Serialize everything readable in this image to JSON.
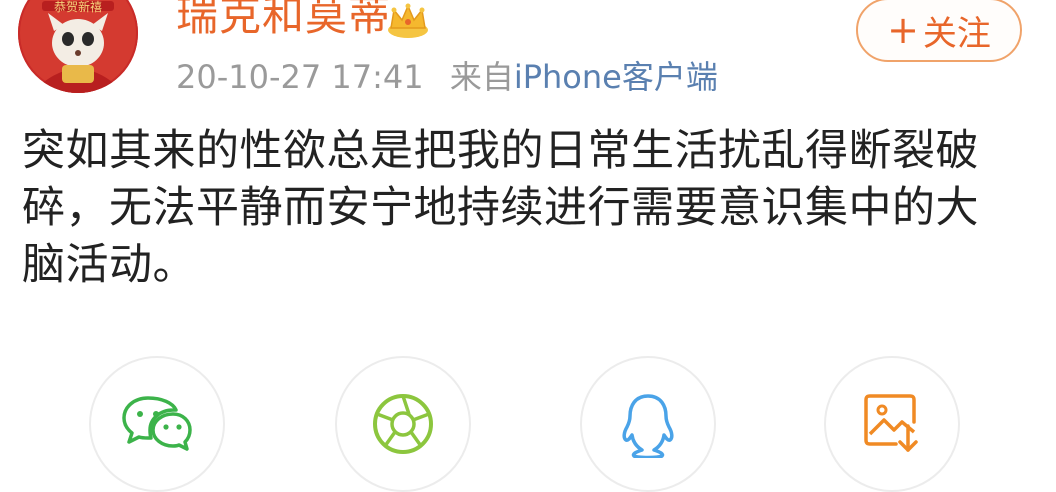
{
  "post": {
    "author": {
      "name": "瑞克和莫蒂",
      "avatar_text": "恭贺新禧",
      "badge_icon": "crown-icon"
    },
    "follow_button": {
      "icon": "plus-icon",
      "label": "关注"
    },
    "meta": {
      "time": "20-10-27 17:41",
      "source_prefix": "来自",
      "source": "iPhone客户端"
    },
    "content": "突如其来的性欲总是把我的日常生活扰乱得断裂破碎，无法平静而安宁地持续进行需要意识集中的大脑活动。"
  },
  "share_bar": {
    "items": [
      {
        "id": "wechat",
        "icon": "wechat-icon",
        "color": "#3cb34a"
      },
      {
        "id": "moments",
        "icon": "camera-aperture-icon",
        "color": "#8cc63e"
      },
      {
        "id": "qq",
        "icon": "qq-penguin-icon",
        "color": "#4aa3e8"
      },
      {
        "id": "save-image",
        "icon": "save-image-icon",
        "color": "#f08a24"
      }
    ]
  },
  "colors": {
    "accent": "#e8662a",
    "link": "#5a80b0",
    "meta": "#9a9a9a",
    "text": "#222222"
  }
}
